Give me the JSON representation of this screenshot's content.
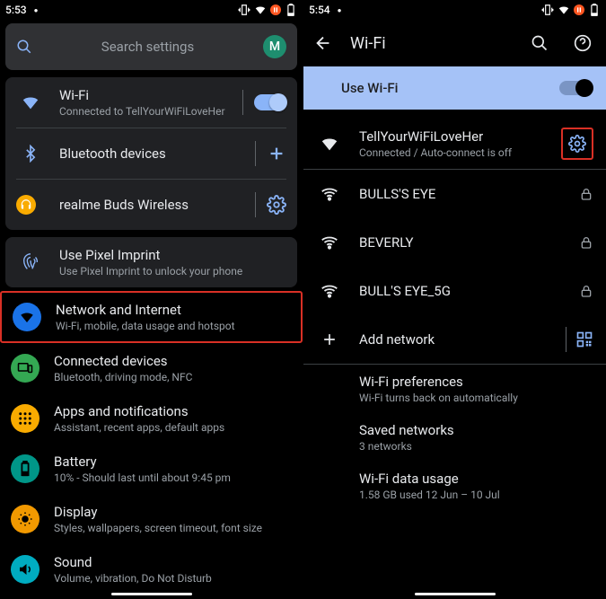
{
  "left": {
    "status": {
      "time": "5:53"
    },
    "search": {
      "placeholder": "Search settings",
      "avatar_initial": "M"
    },
    "wifi": {
      "title": "Wi-Fi",
      "subtitle": "Connected to TellYourWiFiLoveHer"
    },
    "bluetooth": {
      "title": "Bluetooth devices"
    },
    "realme": {
      "title": "realme Buds Wireless"
    },
    "pixel": {
      "title": "Use Pixel Imprint",
      "subtitle": "Use Pixel Imprint to unlock your phone"
    },
    "items": [
      {
        "title": "Network and Internet",
        "sub": "Wi-Fi, mobile, data usage and hotspot",
        "color": "#1a73e8",
        "icon": "wifi",
        "highlight": true
      },
      {
        "title": "Connected devices",
        "sub": "Bluetooth, driving mode, NFC",
        "color": "#34a853",
        "icon": "devices"
      },
      {
        "title": "Apps and notifications",
        "sub": "Assistant, recent apps, default apps",
        "color": "#f9ab00",
        "icon": "apps"
      },
      {
        "title": "Battery",
        "sub": "10% - Should last until about 9:45 pm",
        "color": "#009688",
        "icon": "battery"
      },
      {
        "title": "Display",
        "sub": "Styles, wallpapers, screen timeout, font size",
        "color": "#f29900",
        "icon": "display"
      },
      {
        "title": "Sound",
        "sub": "Volume, vibration, Do Not Disturb",
        "color": "#00acc1",
        "icon": "sound"
      }
    ]
  },
  "right": {
    "status": {
      "time": "5:54"
    },
    "titlebar": {
      "title": "Wi-Fi"
    },
    "use_wifi": {
      "label": "Use Wi-Fi"
    },
    "connected": {
      "ssid": "TellYourWiFiLoveHer",
      "status": "Connected / Auto-connect is off"
    },
    "networks": [
      {
        "ssid": "BULLS'S EYE"
      },
      {
        "ssid": "BEVERLY"
      },
      {
        "ssid": "BULL'S EYE_5G"
      }
    ],
    "add": "Add network",
    "prefs": {
      "title": "Wi-Fi preferences",
      "sub": "Wi-Fi turns back on automatically"
    },
    "saved": {
      "title": "Saved networks",
      "sub": "3 networks"
    },
    "usage": {
      "title": "Wi-Fi data usage",
      "sub": "1.58 GB used 12 Jun – 10 Jul"
    }
  }
}
